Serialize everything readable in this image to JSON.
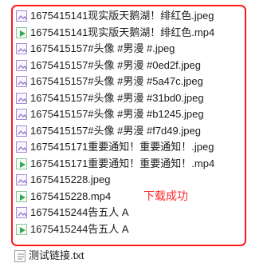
{
  "files": [
    {
      "name": "1675415141现实版天鹅湖！绯红色.jpeg",
      "type": "image"
    },
    {
      "name": "1675415141现实版天鹅湖！绯红色.mp4",
      "type": "video"
    },
    {
      "name": "1675415157#头像 #男漫 #.jpeg",
      "type": "image"
    },
    {
      "name": "1675415157#头像 #男漫 #0ed2f.jpeg",
      "type": "image"
    },
    {
      "name": "1675415157#头像 #男漫 #5a47c.jpeg",
      "type": "image"
    },
    {
      "name": "1675415157#头像 #男漫 #31bd0.jpeg",
      "type": "image"
    },
    {
      "name": "1675415157#头像 #男漫 #b1245.jpeg",
      "type": "image"
    },
    {
      "name": "1675415157#头像 #男漫 #f7d49.jpeg",
      "type": "image"
    },
    {
      "name": "1675415171重要通知！重要通知！.jpeg",
      "type": "image"
    },
    {
      "name": "1675415171重要通知！重要通知！.mp4",
      "type": "video"
    },
    {
      "name": "1675415228.jpeg",
      "type": "image"
    },
    {
      "name": "1675415228.mp4",
      "type": "video"
    },
    {
      "name": "1675415244告五人 A",
      "type": "image"
    },
    {
      "name": "1675415244告五人 A",
      "type": "video"
    }
  ],
  "status_label": "下载成功",
  "bottom_file": {
    "name": "测试链接.txt",
    "icon": "text-file-icon"
  },
  "colors": {
    "highlight_border": "#ff1a1a",
    "status_text": "#ff2a2a",
    "image_icon": "#a58bd3",
    "video_icon": "#8bc79a"
  }
}
